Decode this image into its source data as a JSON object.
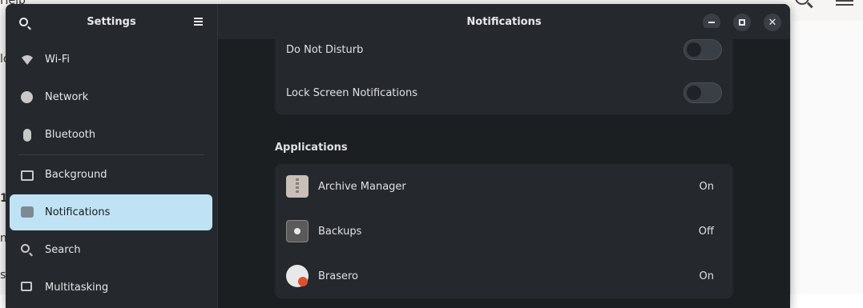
{
  "background_app": {
    "top_left_text": "Help",
    "left_fragments": [
      "lo",
      "1",
      "m",
      "s"
    ]
  },
  "sidebar": {
    "title": "Settings",
    "items": [
      {
        "label": "Wi-Fi",
        "icon": "wifi-icon"
      },
      {
        "label": "Network",
        "icon": "network-icon"
      },
      {
        "label": "Bluetooth",
        "icon": "bluetooth-icon"
      },
      {
        "label": "Background",
        "icon": "background-icon"
      },
      {
        "label": "Notifications",
        "icon": "notifications-icon",
        "active": true
      },
      {
        "label": "Search",
        "icon": "search-icon"
      },
      {
        "label": "Multitasking",
        "icon": "multitasking-icon"
      }
    ]
  },
  "header": {
    "title": "Notifications"
  },
  "settings": {
    "do_not_disturb": {
      "label": "Do Not Disturb",
      "value": false
    },
    "lock_screen": {
      "label": "Lock Screen Notifications",
      "value": false
    }
  },
  "applications": {
    "title": "Applications",
    "items": [
      {
        "name": "Archive Manager",
        "state": "On",
        "icon": "archive-manager-icon"
      },
      {
        "name": "Backups",
        "state": "Off",
        "icon": "backups-icon"
      },
      {
        "name": "Brasero",
        "state": "On",
        "icon": "brasero-icon"
      }
    ]
  },
  "colors": {
    "window_bg": "#1c1f22",
    "sidebar_bg": "#25292e",
    "active_item_bg": "#bfe3f5",
    "card_bg": "#25292e"
  }
}
